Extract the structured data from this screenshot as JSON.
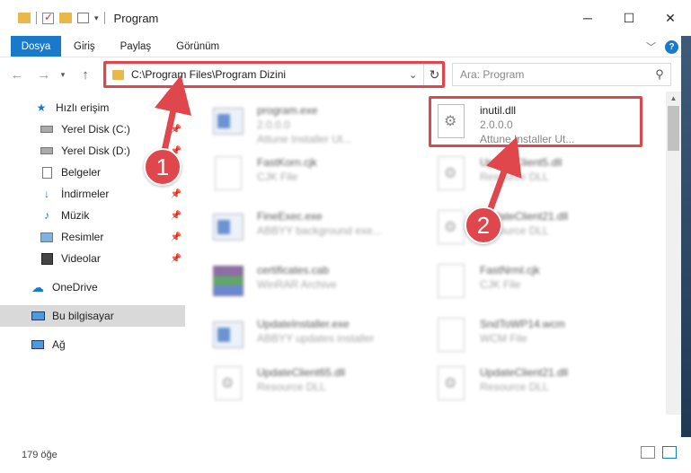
{
  "window": {
    "title": "Program",
    "controls": {
      "minimize": "─",
      "maximize": "☐",
      "close": "✕"
    }
  },
  "ribbon": {
    "tabs": [
      "Dosya",
      "Giriş",
      "Paylaş",
      "Görünüm"
    ]
  },
  "navigation": {
    "address": "C:\\Program Files\\Program Dizini",
    "search_placeholder": "Ara: Program"
  },
  "sidebar": {
    "items": [
      {
        "label": "Hızlı erişim",
        "icon": "star-icon"
      },
      {
        "label": "Yerel Disk (C:)",
        "icon": "drive-icon"
      },
      {
        "label": "Yerel Disk (D:)",
        "icon": "drive-icon"
      },
      {
        "label": "Belgeler",
        "icon": "document-icon"
      },
      {
        "label": "İndirmeler",
        "icon": "download-icon"
      },
      {
        "label": "Müzik",
        "icon": "music-icon"
      },
      {
        "label": "Resimler",
        "icon": "picture-icon"
      },
      {
        "label": "Videolar",
        "icon": "video-icon"
      },
      {
        "label": "OneDrive",
        "icon": "cloud-icon"
      },
      {
        "label": "Bu bilgisayar",
        "icon": "computer-icon"
      },
      {
        "label": "Ağ",
        "icon": "network-icon"
      }
    ]
  },
  "files": [
    {
      "name": "program.exe",
      "line2": "2.0.0.0",
      "line3": "Attune Installer Ut...",
      "type": "exe",
      "blurred": true
    },
    {
      "name": "inutil.dll",
      "line2": "2.0.0.0",
      "line3": "Attune Installer Ut...",
      "type": "dll",
      "blurred": false
    },
    {
      "name": "FastKorn.cjk",
      "line2": "CJK File",
      "line3": "",
      "type": "doc",
      "blurred": true
    },
    {
      "name": "UpdateClient5.dll",
      "line2": "Resource DLL",
      "line3": "",
      "type": "dll",
      "blurred": true
    },
    {
      "name": "FineExec.exe",
      "line2": "ABBYY background exe...",
      "line3": "",
      "type": "exe",
      "blurred": true
    },
    {
      "name": "UpdateClient21.dll",
      "line2": "Resource DLL",
      "line3": "",
      "type": "dll",
      "blurred": true
    },
    {
      "name": "certificates.cab",
      "line2": "WinRAR Archive",
      "line3": "",
      "type": "rar",
      "blurred": true
    },
    {
      "name": "FastNrml.cjk",
      "line2": "CJK File",
      "line3": "",
      "type": "doc",
      "blurred": true
    },
    {
      "name": "UpdateInstaller.exe",
      "line2": "ABBYY updates installer",
      "line3": "",
      "type": "exe",
      "blurred": true
    },
    {
      "name": "SndToWP14.wcm",
      "line2": "WCM File",
      "line3": "",
      "type": "doc",
      "blurred": true
    },
    {
      "name": "UpdateClient65.dll",
      "line2": "Resource DLL",
      "line3": "",
      "type": "dll",
      "blurred": true
    },
    {
      "name": "UpdateClient21.dll",
      "line2": "Resource DLL",
      "line3": "",
      "type": "dll",
      "blurred": true
    }
  ],
  "status": {
    "item_count": "179 öğe"
  },
  "annotations": {
    "callout1": "1",
    "callout2": "2",
    "color": "#e0474c"
  }
}
